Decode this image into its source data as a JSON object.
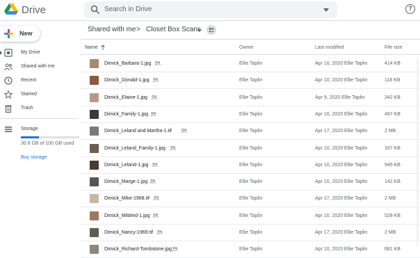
{
  "app": {
    "brand": "Drive"
  },
  "search": {
    "placeholder": "Search in Drive"
  },
  "sidebar": {
    "new_label": "New",
    "items": [
      {
        "label": "My Drive",
        "icon": "my-drive-icon"
      },
      {
        "label": "Shared with me",
        "icon": "people-icon"
      },
      {
        "label": "Recent",
        "icon": "clock-icon"
      },
      {
        "label": "Starred",
        "icon": "star-icon"
      },
      {
        "label": "Trash",
        "icon": "trash-icon"
      },
      {
        "label": "Storage",
        "icon": "storage-icon"
      }
    ],
    "storage_text": "30.8 GB of 100 GB used",
    "storage_fraction": 0.308,
    "buy_label": "Buy storage"
  },
  "breadcrumb": {
    "parent": "Shared with me",
    "separator": ">",
    "current": "Closet Box Scans"
  },
  "columns": {
    "name": "Name",
    "owner": "Owner",
    "modified": "Last modified",
    "size": "File size"
  },
  "files": [
    {
      "name": "Dimick_Barbara-1.jpg",
      "owner": "Ellie Taplin",
      "modified": "Apr 10, 2020 Ellie Taplin",
      "size": "414 KB",
      "thumb": "#a78a6e"
    },
    {
      "name": "Dimick_Donald-1.jpg",
      "owner": "Ellie Taplin",
      "modified": "Apr 10, 2020 Ellie Taplin",
      "size": "118 KB",
      "thumb": "#8a5a44"
    },
    {
      "name": "Dimick_Elaine-1.jpg",
      "owner": "Ellie Taplin",
      "modified": "Apr 9, 2020 Ellie Taplin",
      "size": "342 KB",
      "thumb": "#b89a84"
    },
    {
      "name": "Dimick_Family-1.jpg",
      "owner": "Ellie Taplin",
      "modified": "Apr 10, 2020 Ellie Taplin",
      "size": "487 KB",
      "thumb": "#3d3a36"
    },
    {
      "name": "Dimick_Leland and Martha-1.tif",
      "owner": "Ellie Taplin",
      "modified": "Apr 17, 2020 Ellie Taplin",
      "size": "2 MB",
      "thumb": "#7c7a76"
    },
    {
      "name": "Dimick_Leland_Family-1.jpg",
      "owner": "Ellie Taplin",
      "modified": "Apr 10, 2020 Ellie Taplin",
      "size": "337 KB",
      "thumb": "#6e5c4c"
    },
    {
      "name": "Dimick_Leland-1.jpg",
      "owner": "Ellie Taplin",
      "modified": "Apr 10, 2020 Ellie Taplin",
      "size": "946 KB",
      "thumb": "#4a3a30"
    },
    {
      "name": "Dimick_Marge-1.jpg",
      "owner": "Ellie Taplin",
      "modified": "Apr 10, 2020 Ellie Taplin",
      "size": "142 KB",
      "thumb": "#5a5650"
    },
    {
      "name": "Dimick_Mike-1968.tif",
      "owner": "Ellie Taplin",
      "modified": "Apr 17, 2020 Ellie Taplin",
      "size": "2 MB",
      "thumb": "#c9b7a2"
    },
    {
      "name": "Dimick_Mildred-1.jpg",
      "owner": "Ellie Taplin",
      "modified": "Apr 10, 2020 Ellie Taplin",
      "size": "528 KB",
      "thumb": "#9e7862"
    },
    {
      "name": "Dimick_Nancy-1969.tif",
      "owner": "Ellie Taplin",
      "modified": "Apr 17, 2020 Ellie Taplin",
      "size": "2 MB",
      "thumb": "#57624c"
    },
    {
      "name": "Dimick_Richard-Tombstone.jpg",
      "owner": "Ellie Taplin",
      "modified": "Apr 10, 2020 Ellie Taplin",
      "size": "681 KB",
      "thumb": "#8f8676"
    }
  ],
  "colors": {
    "accent": "#1a73e8",
    "text": "#3c4043",
    "muted": "#5f6368"
  }
}
